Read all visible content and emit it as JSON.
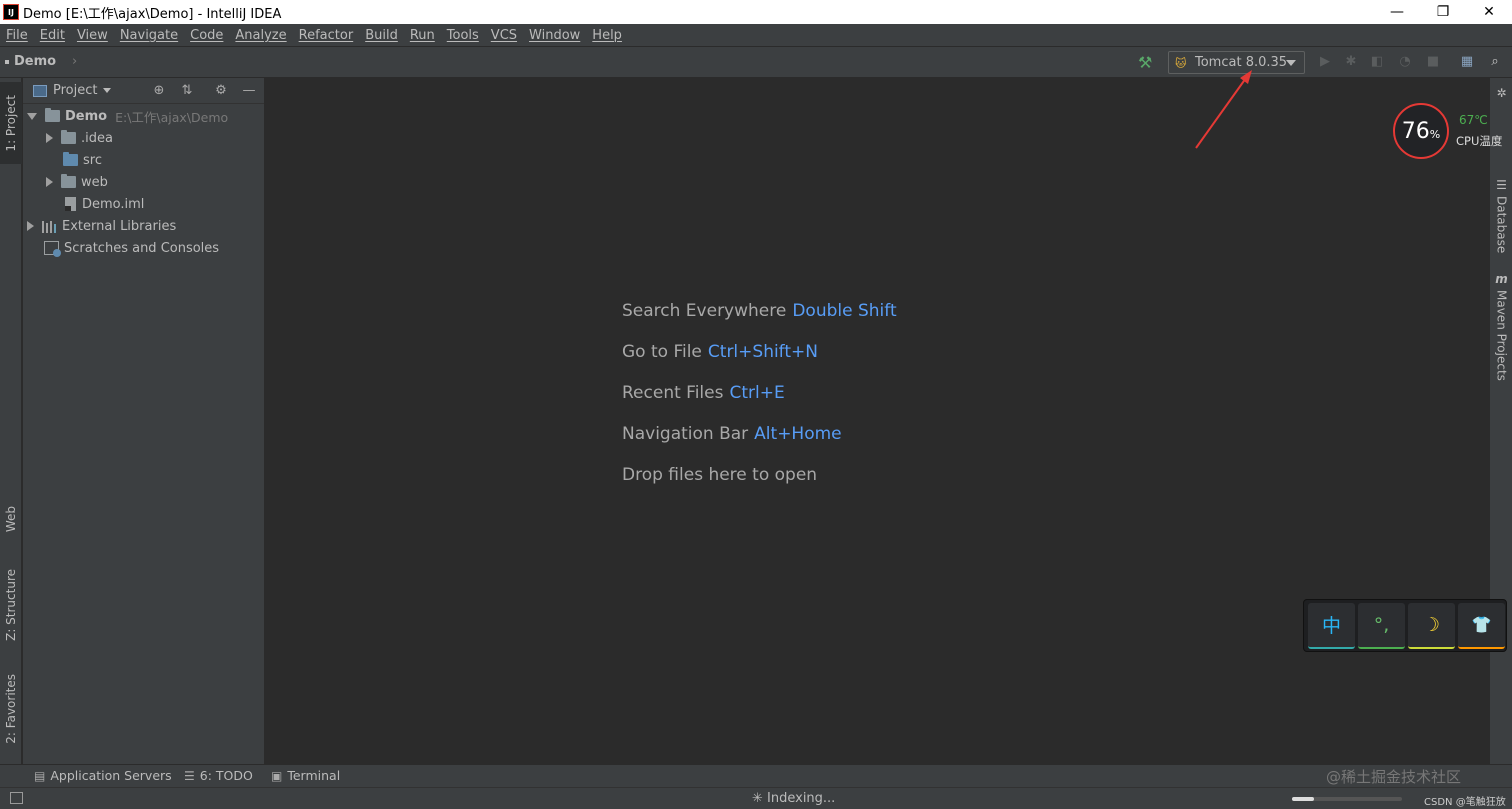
{
  "window": {
    "title": "Demo [E:\\工作\\ajax\\Demo] - IntelliJ IDEA",
    "logo_text": "IJ",
    "controls": [
      "—",
      "❐",
      "✕"
    ]
  },
  "menu": [
    "File",
    "Edit",
    "View",
    "Navigate",
    "Code",
    "Analyze",
    "Refactor",
    "Build",
    "Run",
    "Tools",
    "VCS",
    "Window",
    "Help"
  ],
  "navbar": {
    "breadcrumb": "Demo",
    "run_config": "Tomcat 8.0.35"
  },
  "left_tabs": {
    "project": "1: Project",
    "web": "Web",
    "structure": "Z: Structure",
    "favorites": "2: Favorites"
  },
  "right_tabs": {
    "database": "Database",
    "maven": "Maven Projects",
    "maven_icon": "m"
  },
  "project_panel": {
    "title": "Project",
    "tree": {
      "root_name": "Demo",
      "root_path": "E:\\工作\\ajax\\Demo",
      "idea": ".idea",
      "src": "src",
      "web": "web",
      "iml": "Demo.iml",
      "ext_libs": "External Libraries",
      "scratches": "Scratches and Consoles"
    }
  },
  "editor": {
    "hints": [
      {
        "text": "Search Everywhere",
        "key": "Double Shift"
      },
      {
        "text": "Go to File",
        "key": "Ctrl+Shift+N"
      },
      {
        "text": "Recent Files",
        "key": "Ctrl+E"
      },
      {
        "text": "Navigation Bar",
        "key": "Alt+Home"
      },
      {
        "text": "Drop files here to open",
        "key": ""
      }
    ]
  },
  "cpu_widget": {
    "usage": "76",
    "unit": "%",
    "temp": "67℃",
    "label": "CPU温度"
  },
  "ime_bar": {
    "keys": [
      "中",
      "°,",
      "☽",
      "👕"
    ]
  },
  "bottom_tabs": {
    "app_servers": "Application Servers",
    "todo": "6: TODO",
    "terminal": "Terminal",
    "watermark": "@稀土掘金技术社区"
  },
  "status": {
    "indexing": "Indexing...",
    "progress": 0.2,
    "credit": "CSDN @笔触狂放"
  },
  "colors": {
    "editor_bg": "#2b2b2b",
    "panel_bg": "#3c3f41",
    "shortcut_blue": "#589df6",
    "annotation_red": "#e53935"
  }
}
